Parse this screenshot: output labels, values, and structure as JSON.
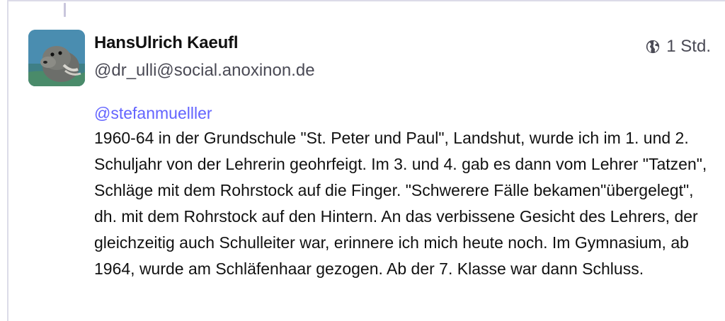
{
  "status": {
    "author": {
      "display_name": "HansUlrich Kaeufl",
      "handle": "@dr_ulli@social.anoxinon.de",
      "avatar_icon": "seal-avatar"
    },
    "visibility_icon": "globe-icon",
    "timestamp": "1 Std.",
    "mention": "@stefanmuelller",
    "text": "1960-64 in der Grundschule \"St. Peter und Paul\", Landshut, wurde ich im 1. und 2. Schuljahr von der Lehrerin geohrfeigt. Im 3. und 4. gab es dann vom Lehrer \"Tatzen\", Schläge mit dem Rohrstock auf die Finger. \"Schwerere Fälle bekamen\"übergelegt\", dh. mit dem Rohrstock auf den Hintern. An das verbissene Gesicht des Lehrers, der gleichzeitig auch Schulleiter war, erinnere ich mich heute noch. Im Gymnasium, ab 1964, wurde am Schläfenhaar gezogen. Ab der 7. Klasse war dann Schluss."
  },
  "colors": {
    "mention": "#6364ff",
    "border": "#dcdbe8",
    "thread_line": "#c9c6dc",
    "secondary_text": "#4a4a55"
  }
}
